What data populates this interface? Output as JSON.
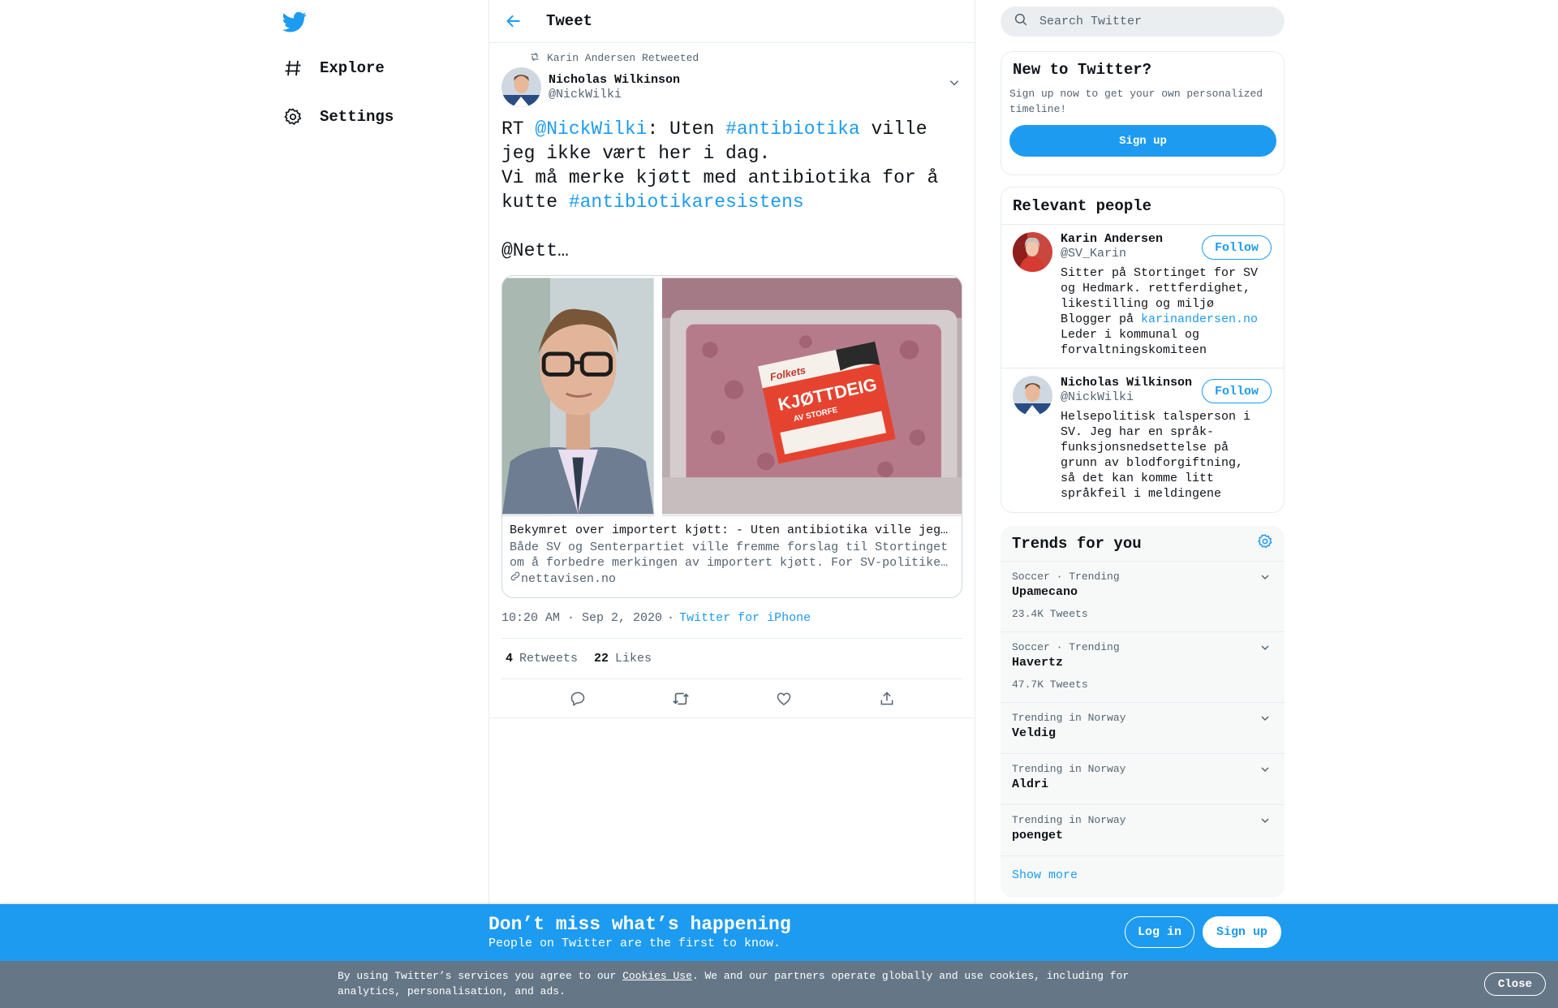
{
  "brand": {
    "accent": "#1d9bf0",
    "text": "#0f1419",
    "muted": "#536471",
    "cookie_bg": "#657786"
  },
  "nav": {
    "logo_icon": "twitter-bird-icon",
    "items": [
      {
        "label": "Explore",
        "icon": "hashtag-icon"
      },
      {
        "label": "Settings",
        "icon": "gear-icon"
      }
    ]
  },
  "header": {
    "title": "Tweet",
    "back_icon": "back-arrow-icon"
  },
  "tweet": {
    "retweeted_by": "Karin Andersen Retweeted",
    "author_name": "Nicholas Wilkinson",
    "author_handle": "@NickWilki",
    "text_parts": {
      "p1": "RT ",
      "mention": "@NickWilki",
      "p2": ": Uten ",
      "tag1": "#antibiotika",
      "p3": " ville jeg ikke vært her i dag.\nVi må merke kjøtt med antibiotika for å kutte ",
      "tag2": "#antibiotikaresistens",
      "p4": "\n\n@Nett…"
    },
    "card": {
      "title": "Bekymret over importert kjøtt: - Uten antibiotika ville jeg…",
      "description": "Både SV og Senterpartiet ville fremme forslag til Stortinget om å forbedre merkingen av importert kjøtt. For SV-politike…",
      "domain": "nettavisen.no",
      "package_label_1": "KJØTTDEIG",
      "package_label_2": "AV STORFE",
      "brand_label": "Folkets"
    },
    "time": "10:20 AM · Sep 2, 2020",
    "dot": "·",
    "source": "Twitter for iPhone",
    "retweets_count": "4",
    "retweets_label": "Retweets",
    "likes_count": "22",
    "likes_label": "Likes",
    "actions": [
      "reply-icon",
      "retweet-icon",
      "like-icon",
      "share-icon"
    ]
  },
  "search": {
    "placeholder": "Search Twitter"
  },
  "new_panel": {
    "title": "New to Twitter?",
    "subtitle": "Sign up now to get your own personalized timeline!",
    "button": "Sign up"
  },
  "people": {
    "title": "Relevant people",
    "items": [
      {
        "name": "Karin Andersen",
        "handle": "@SV_Karin",
        "bio_1": "Sitter på Stortinget for SV og Hedmark. rettferdighet, likestilling og miljø\nBlogger på ",
        "bio_link": "karinandersen.no",
        "bio_2": "\nLeder i kommunal og forvaltningskomiteen",
        "follow": "Follow"
      },
      {
        "name": "Nicholas Wilkinson",
        "handle": "@NickWilki",
        "bio_1": "Helsepolitisk talsperson i SV. Jeg har en språk-funksjonsnedsettelse på grunn av blodforgiftning, så det kan komme litt språkfeil i meldingene",
        "follow": "Follow"
      }
    ]
  },
  "trends": {
    "title": "Trends for you",
    "items": [
      {
        "context": "Soccer · Trending",
        "name": "Upamecano",
        "count": "23.4K Tweets"
      },
      {
        "context": "Soccer · Trending",
        "name": "Havertz",
        "count": "47.7K Tweets"
      },
      {
        "context": "Trending in Norway",
        "name": "Veldig"
      },
      {
        "context": "Trending in Norway",
        "name": "Aldri"
      },
      {
        "context": "Trending in Norway",
        "name": "poenget"
      }
    ],
    "show_more": "Show more"
  },
  "promo": {
    "title": "Don’t miss what’s happening",
    "subtitle": "People on Twitter are the first to know.",
    "login": "Log in",
    "signup": "Sign up"
  },
  "cookie": {
    "text_1": "By using Twitter’s services you agree to our ",
    "link": "Cookies Use",
    "text_2": ". We and our partners operate globally and use cookies, including for analytics, personalisation, and ads.",
    "close": "Close"
  }
}
